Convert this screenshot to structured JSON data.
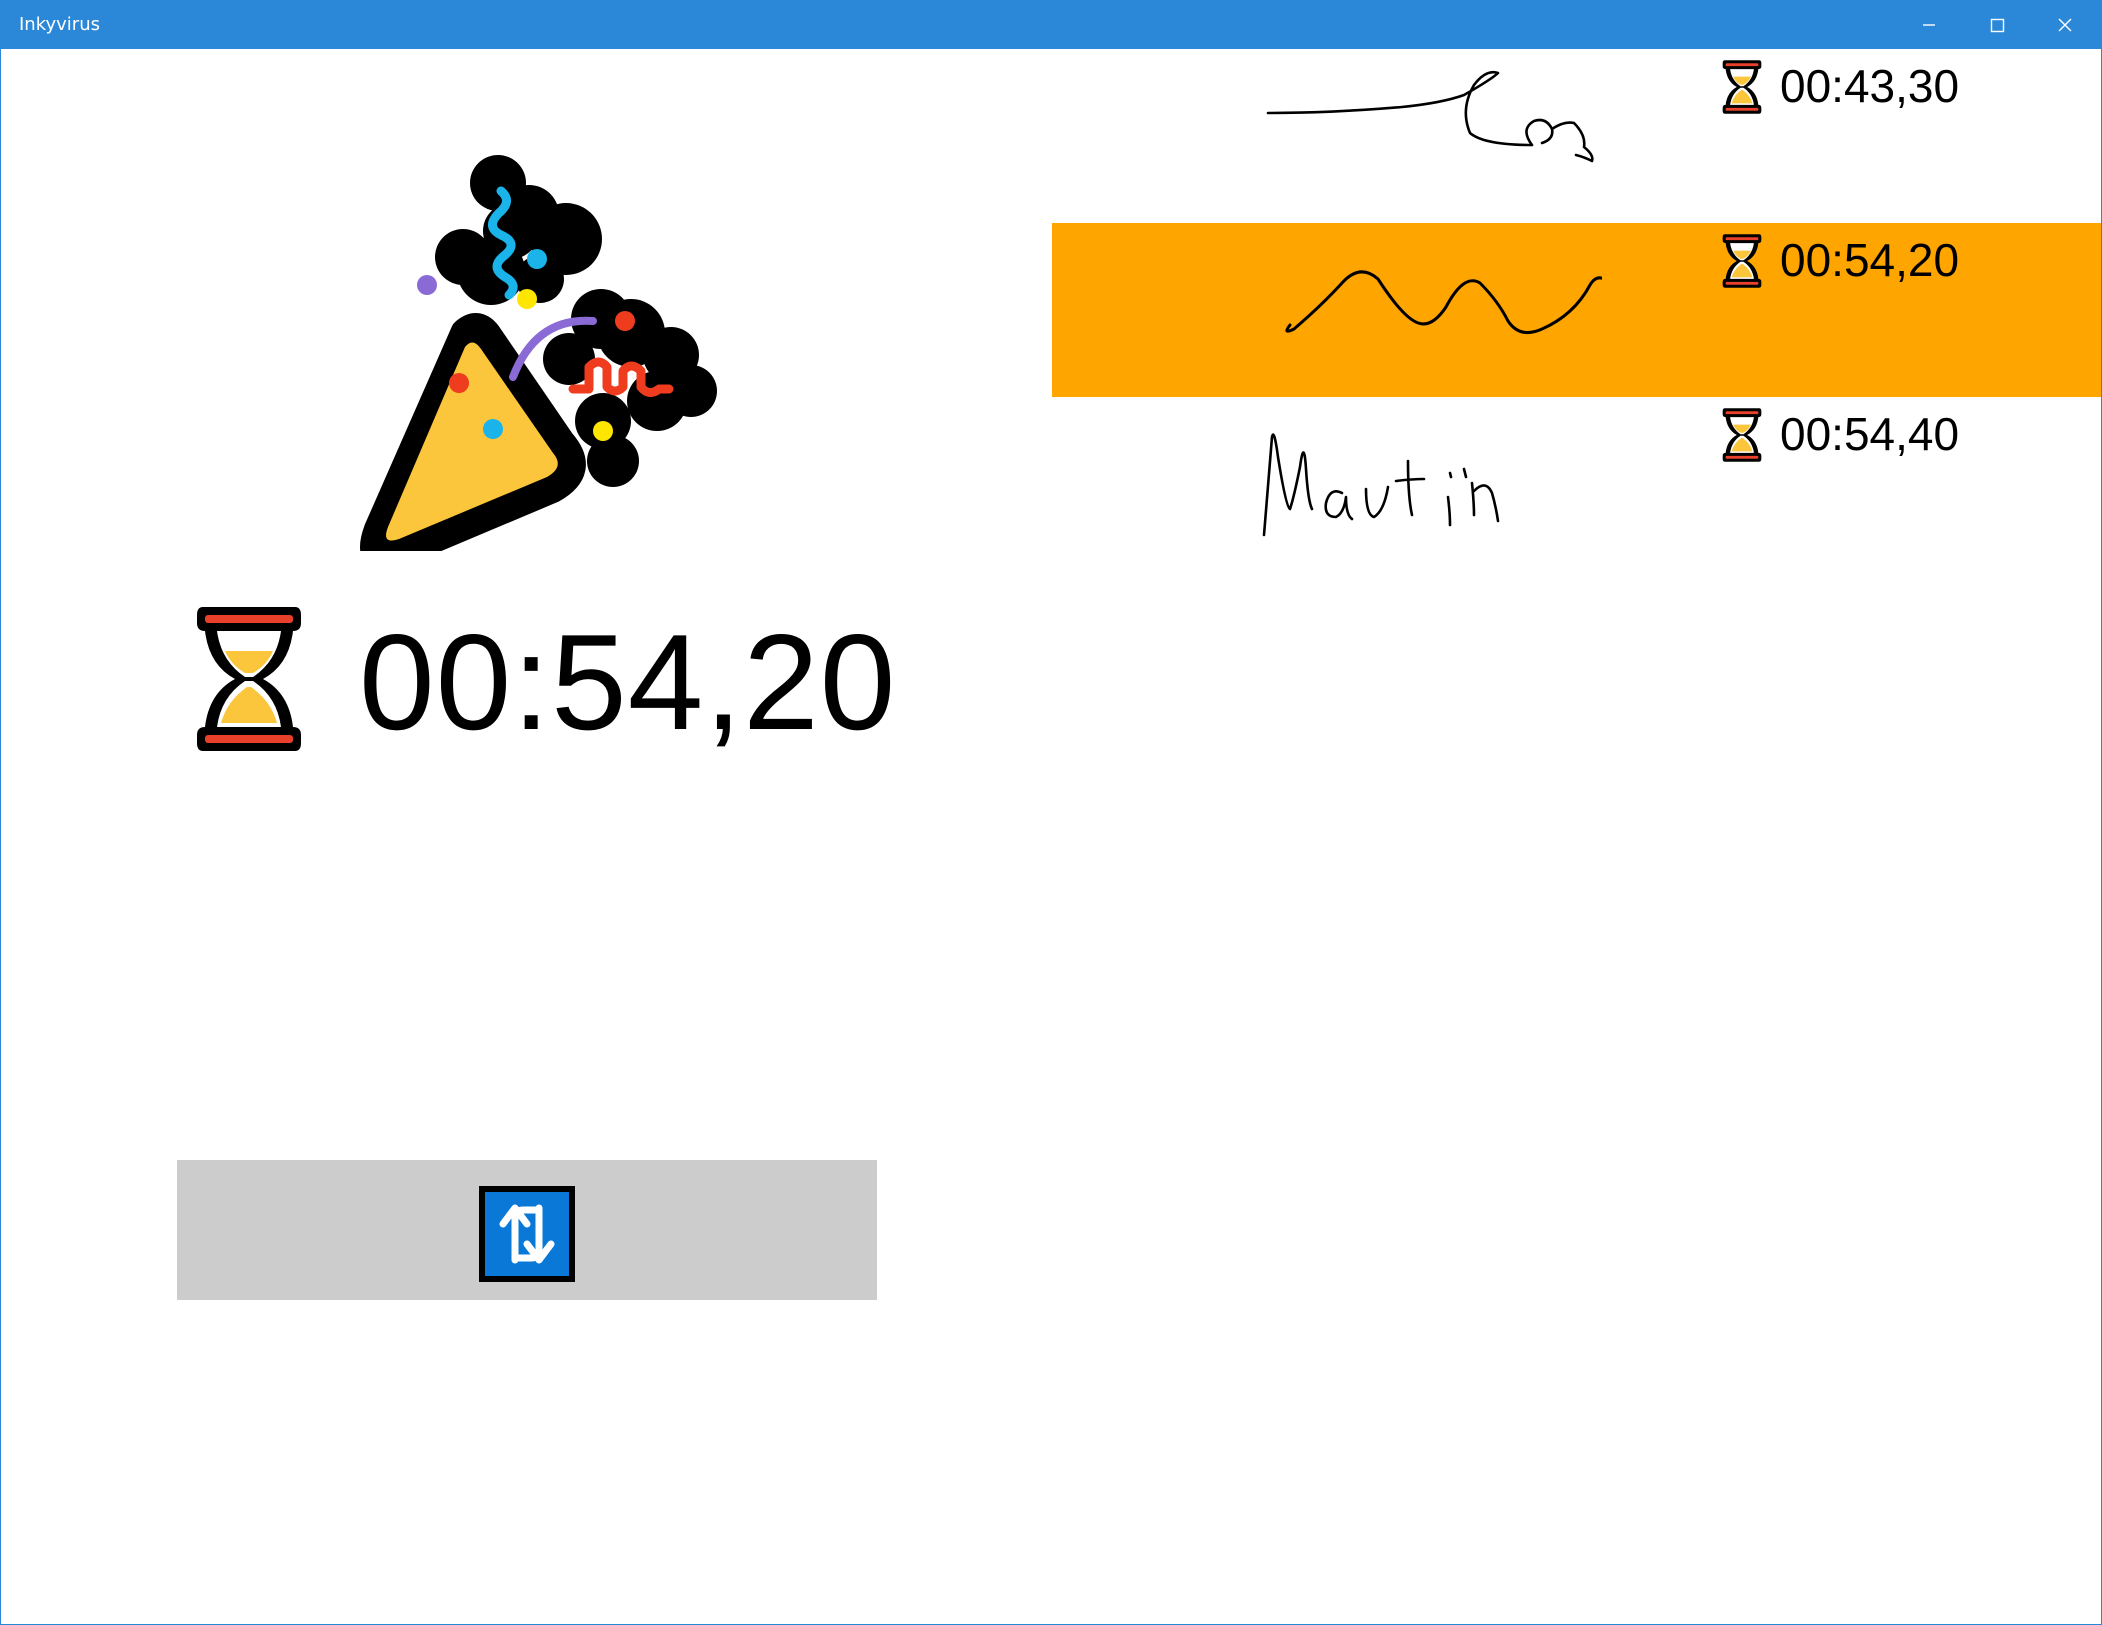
{
  "window": {
    "title": "Inkyvirus",
    "titlebar_color": "#2b88d8",
    "controls": [
      "minimize-icon",
      "maximize-icon",
      "close-icon"
    ]
  },
  "main": {
    "celebration_icon": "party-popper-icon",
    "current_time": "00:54,20",
    "timer_icon": "hourglass-icon",
    "reset_icon": "repeat-arrows-icon",
    "reset_bar_color": "#cccccc"
  },
  "leaderboard": {
    "highlight_color": "#ffa500",
    "entries": [
      {
        "time": "00:43,30",
        "highlighted": false,
        "signature": "handwritten-signature"
      },
      {
        "time": "00:54,20",
        "highlighted": true,
        "signature": "handwritten-wave"
      },
      {
        "time": "00:54,40",
        "highlighted": false,
        "signature": "handwritten-name"
      }
    ]
  }
}
